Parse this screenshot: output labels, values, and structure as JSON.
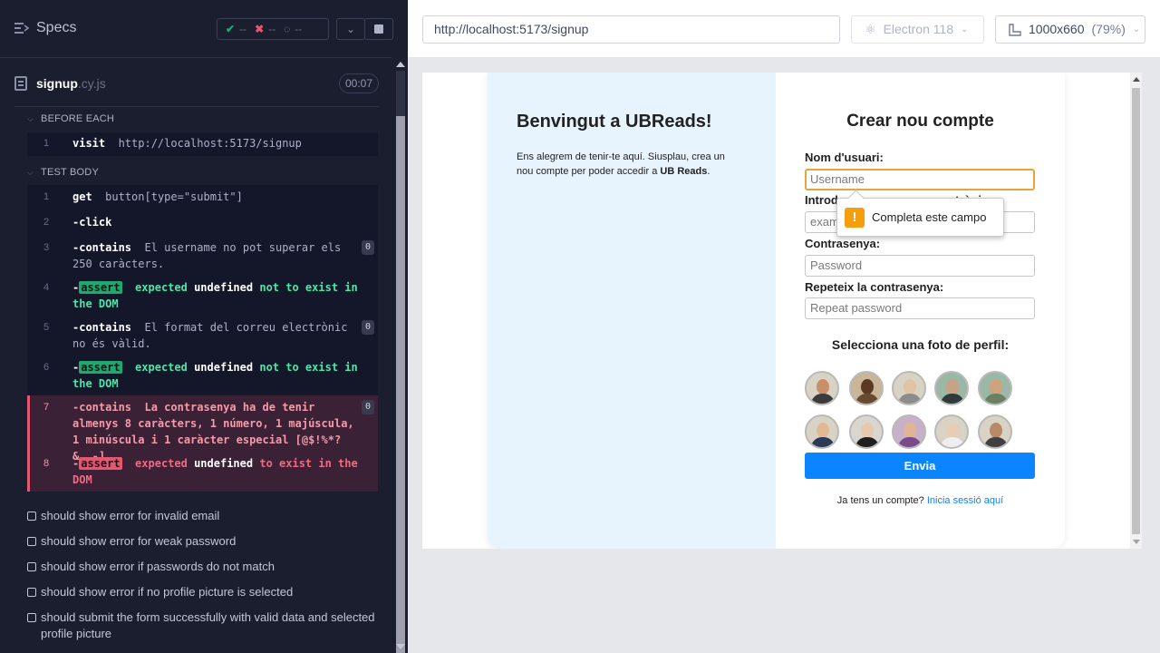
{
  "runner": {
    "specs_label": "Specs",
    "stats": {
      "passed": "--",
      "failed": "--",
      "pending": "--"
    },
    "file": {
      "name": "signup",
      "ext": ".cy.js",
      "timer": "00:07"
    }
  },
  "before_each": {
    "title": "BEFORE EACH",
    "commands": [
      {
        "num": "1",
        "name": "visit",
        "msg": "http://localhost:5173/signup"
      }
    ]
  },
  "test_body": {
    "title": "TEST BODY",
    "commands": [
      {
        "num": "1",
        "name": "get",
        "msg": "button[type=\"submit\"]"
      },
      {
        "num": "2",
        "name": "-click",
        "msg": ""
      },
      {
        "num": "3",
        "name": "-contains",
        "msg": "El username no pot superar els 250 caràcters.",
        "badge": "0"
      },
      {
        "num": "4",
        "name": "-",
        "tag": "assert",
        "pre": "expected",
        "bold": "undefined",
        "post": "not to exist in the DOM"
      },
      {
        "num": "5",
        "name": "-contains",
        "msg": "El format del correu electrònic no és vàlid.",
        "badge": "0"
      },
      {
        "num": "6",
        "name": "-",
        "tag": "assert",
        "pre": "expected",
        "bold": "undefined",
        "post": "not to exist in the DOM"
      },
      {
        "num": "7",
        "name": "-contains",
        "msg": "La contrasenya ha de tenir almenys 8 caràcters, 1 número, 1 majúscula, 1 minúscula i 1 caràcter especial [@$!%*?&_.-].",
        "badge": "0"
      },
      {
        "num": "8",
        "name": "-",
        "tag": "assert",
        "pre": "expected",
        "bold": "undefined",
        "post": "to exist in the DOM"
      }
    ]
  },
  "pending_tests": [
    "should show error for invalid email",
    "should show error for weak password",
    "should show error if passwords do not match",
    "should show error if no profile picture is selected",
    "should submit the form successfully with valid data and selected profile picture"
  ],
  "browser": {
    "url": "http://localhost:5173/signup",
    "browser_name": "Electron 118",
    "viewport": "1000x660",
    "viewport_display": "1000x660",
    "zoom": "(79%)"
  },
  "app": {
    "welcome_title": "Benvingut a UBReads!",
    "welcome_text": "Ens alegrem de tenir-te aquí. Siusplau, crea un nou compte per poder accedir a ",
    "welcome_brand": "UB Reads",
    "welcome_end": ".",
    "form_title": "Crear nou compte",
    "username_label": "Nom d'usuari:",
    "username_placeholder": "Username",
    "email_label_visible": "Introd",
    "email_label_tail": "ctrònic:",
    "email_placeholder_visible": "exam",
    "password_label": "Contrasenya:",
    "password_placeholder": "Password",
    "repeat_label": "Repeteix la contrasenya:",
    "repeat_placeholder": "Repeat password",
    "picture_title": "Selecciona una foto de perfil:",
    "submit_label": "Envia",
    "login_prompt": "Ja tens un compte? ",
    "login_link": "Inicia sessió aquí",
    "tooltip": "Completa este campo"
  },
  "colors": {
    "runner_bg": "#1b1e2e",
    "pass": "#1fa971",
    "fail": "#e45770",
    "primary": "#0a84ff",
    "focus": "#e8a33a"
  }
}
